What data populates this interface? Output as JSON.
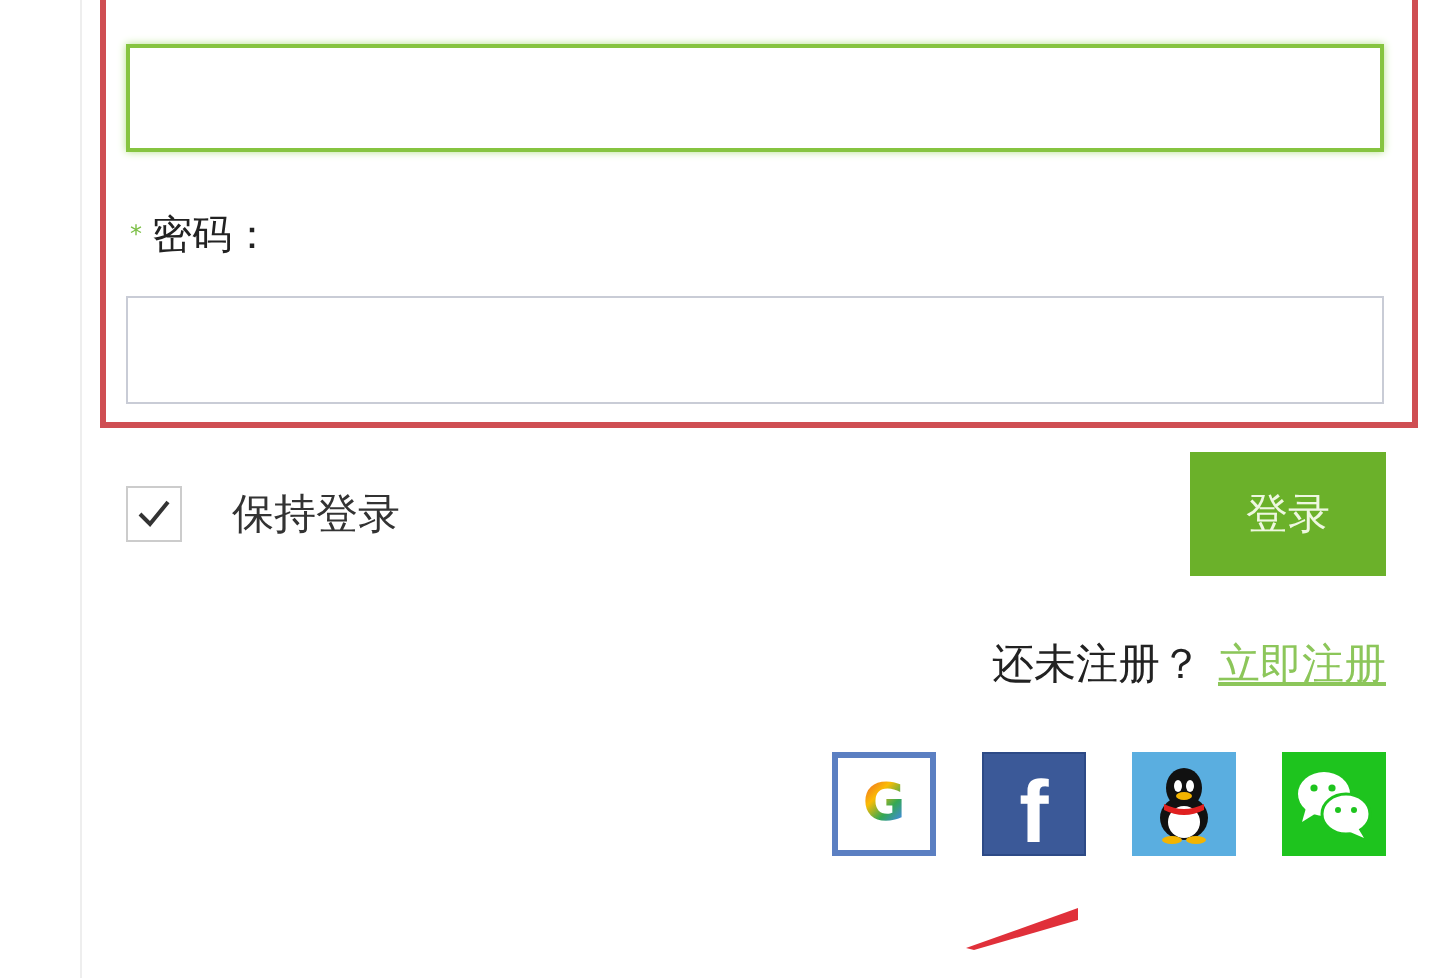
{
  "email_field": {
    "focused": true
  },
  "password_label": {
    "required_mark": "*",
    "text": "密码："
  },
  "password_field": {
    "focused": false
  },
  "keep_logged_in": {
    "label": "保持登录",
    "checked": true
  },
  "login_button": {
    "label": "登录"
  },
  "register_prompt": "还未注册？",
  "register_link": "立即注册",
  "social_logins": [
    {
      "kind": "google",
      "glyph": "G"
    },
    {
      "kind": "facebook",
      "glyph": "f"
    },
    {
      "kind": "qq"
    },
    {
      "kind": "wechat"
    }
  ]
}
